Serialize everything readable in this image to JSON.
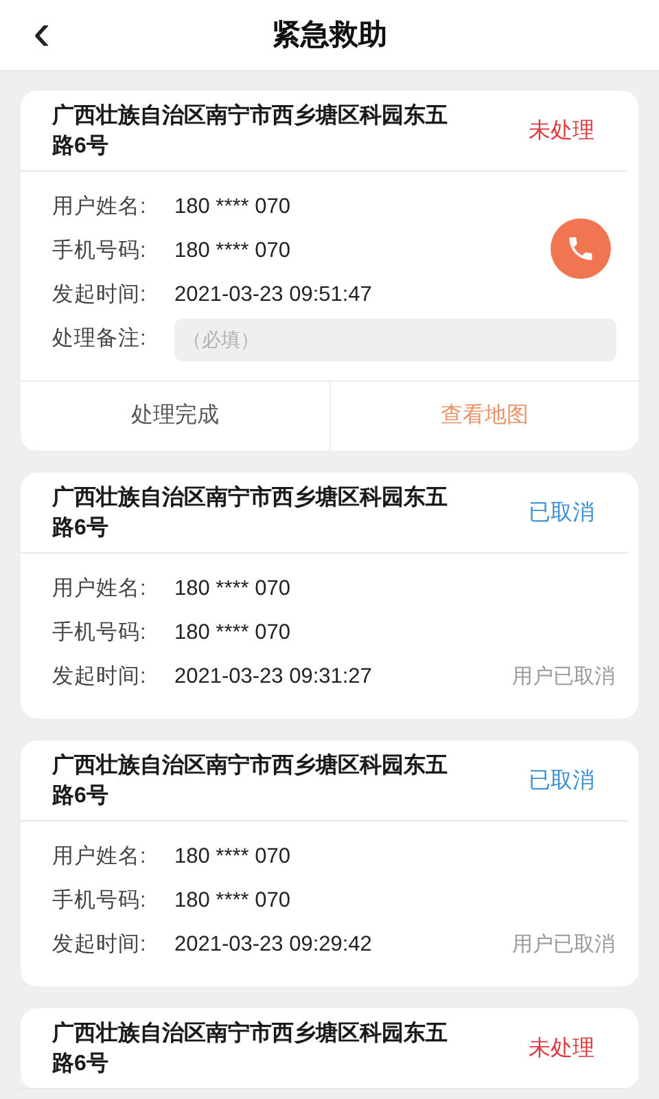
{
  "header": {
    "back_icon": "‹",
    "title": "紧急救助"
  },
  "cards": [
    {
      "kind": "pending",
      "address": "广西壮族自治区南宁市西乡塘区科园东五路6号",
      "status": "未处理",
      "fields": [
        {
          "label": "用户姓名:",
          "value": "180 **** 070"
        },
        {
          "label": "手机号码:",
          "value": "180 **** 070"
        },
        {
          "label": "发起时间:",
          "value": "2021-03-23 09:51:47"
        }
      ],
      "note": {
        "label": "处理备注:",
        "placeholder": "（必填）"
      },
      "actions": [
        {
          "label": "处理完成",
          "kind": "plain"
        },
        {
          "label": "查看地图",
          "kind": "accent"
        }
      ]
    },
    {
      "kind": "cancelled",
      "address": "广西壮族自治区南宁市西乡塘区科园东五路6号",
      "status": "已取消",
      "fields": [
        {
          "label": "用户姓名:",
          "value": "180 **** 070"
        },
        {
          "label": "手机号码:",
          "value": "180 **** 070"
        },
        {
          "label": "发起时间:",
          "value": "2021-03-23 09:31:27"
        }
      ],
      "remark": "用户已取消"
    },
    {
      "kind": "cancelled",
      "address": "广西壮族自治区南宁市西乡塘区科园东五路6号",
      "status": "已取消",
      "fields": [
        {
          "label": "用户姓名:",
          "value": "180 **** 070"
        },
        {
          "label": "手机号码:",
          "value": "180 **** 070"
        },
        {
          "label": "发起时间:",
          "value": "2021-03-23 09:29:42"
        }
      ],
      "remark": "用户已取消"
    },
    {
      "kind": "pending",
      "address": "广西壮族自治区南宁市西乡塘区科园东五路6号",
      "status": "未处理"
    }
  ]
}
